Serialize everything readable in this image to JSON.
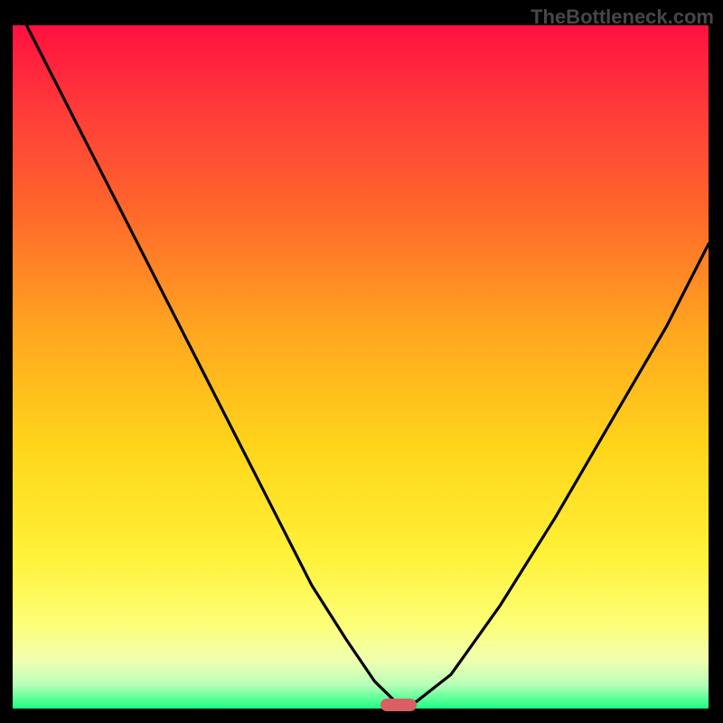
{
  "watermark": "TheBottleneck.com",
  "chart_data": {
    "type": "line",
    "title": "",
    "xlabel": "",
    "ylabel": "",
    "xlim": [
      0,
      1
    ],
    "ylim": [
      0,
      1
    ],
    "grid": false,
    "series": [
      {
        "name": "curve",
        "x": [
          0.02,
          0.1,
          0.18,
          0.26,
          0.32,
          0.38,
          0.43,
          0.48,
          0.52,
          0.55,
          0.58,
          0.63,
          0.7,
          0.78,
          0.86,
          0.94,
          1.0
        ],
        "values": [
          1.0,
          0.84,
          0.68,
          0.52,
          0.4,
          0.28,
          0.18,
          0.1,
          0.04,
          0.01,
          0.01,
          0.05,
          0.15,
          0.28,
          0.42,
          0.56,
          0.68
        ]
      }
    ],
    "marker": {
      "x": 0.555,
      "y": 0.005
    },
    "gradient_stops": [
      {
        "offset": 0.0,
        "color": "#ff1040"
      },
      {
        "offset": 0.12,
        "color": "#ff3a3a"
      },
      {
        "offset": 0.28,
        "color": "#ff6a2a"
      },
      {
        "offset": 0.45,
        "color": "#ffa71f"
      },
      {
        "offset": 0.62,
        "color": "#ffd61a"
      },
      {
        "offset": 0.78,
        "color": "#fff23a"
      },
      {
        "offset": 0.88,
        "color": "#fcff7a"
      },
      {
        "offset": 0.93,
        "color": "#f0ffb0"
      },
      {
        "offset": 0.965,
        "color": "#b8ffb8"
      },
      {
        "offset": 0.985,
        "color": "#5fff9a"
      },
      {
        "offset": 1.0,
        "color": "#1aff82"
      }
    ]
  }
}
